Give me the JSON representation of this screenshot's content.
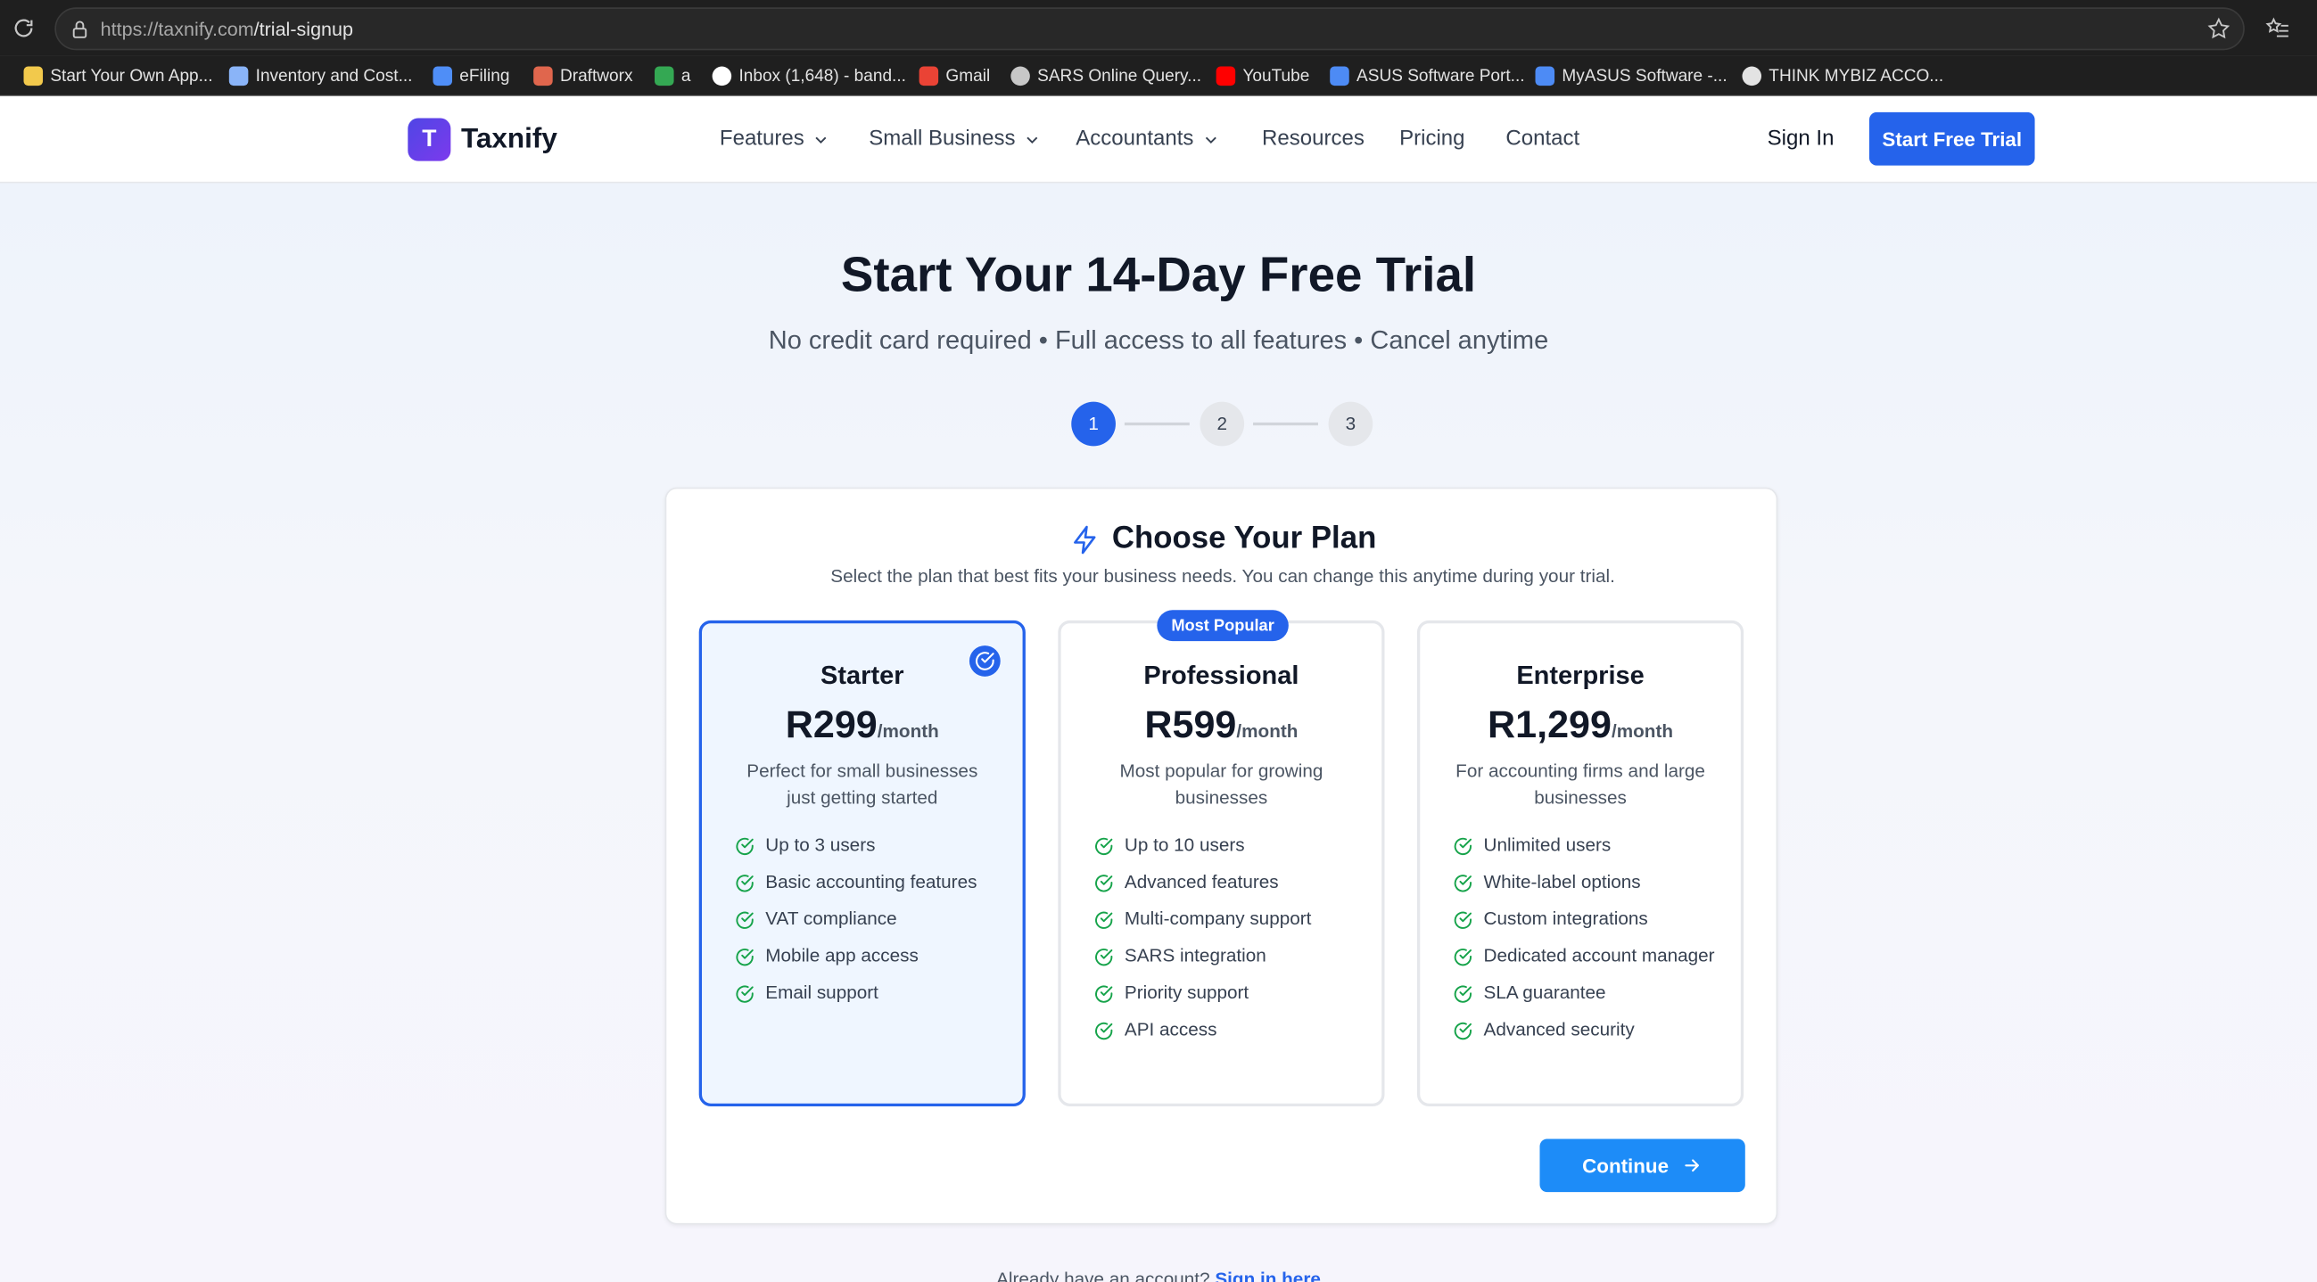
{
  "browser": {
    "url_host": "https://taxnify.com",
    "url_path": "/trial-signup",
    "bookmarks": [
      {
        "label": "Start Your Own App...",
        "icon": "app-favicon",
        "color": "#f2c94c"
      },
      {
        "label": "Inventory and Cost...",
        "icon": "ac-favicon",
        "color": "#8ab4f8"
      },
      {
        "label": "eFiling",
        "icon": "efiling-favicon",
        "color": "#4f8ef7"
      },
      {
        "label": "Draftworx",
        "icon": "draftworx-favicon",
        "color": "#e0664d"
      },
      {
        "label": "a",
        "icon": "leaf-favicon",
        "color": "#34a853"
      },
      {
        "label": "Inbox (1,648) - band...",
        "icon": "google-favicon",
        "color": "#ffffff"
      },
      {
        "label": "Gmail",
        "icon": "gmail-favicon",
        "color": "#ea4335"
      },
      {
        "label": "SARS Online Query...",
        "icon": "globe-favicon",
        "color": "#c7c7c7"
      },
      {
        "label": "YouTube",
        "icon": "youtube-favicon",
        "color": "#ff0000"
      },
      {
        "label": "ASUS Software Port...",
        "icon": "asus-favicon",
        "color": "#4d8bf5"
      },
      {
        "label": "MyASUS Software -...",
        "icon": "myasus-favicon",
        "color": "#4d8bf5"
      },
      {
        "label": "THINK MYBIZ ACCO...",
        "icon": "chatgpt-favicon",
        "color": "#e3e3e3"
      }
    ]
  },
  "nav": {
    "logo_letter": "T",
    "brand": "Taxnify",
    "items": [
      {
        "label": "Features",
        "dropdown": true
      },
      {
        "label": "Small Business",
        "dropdown": true
      },
      {
        "label": "Accountants",
        "dropdown": true
      },
      {
        "label": "Resources",
        "dropdown": false
      },
      {
        "label": "Pricing",
        "dropdown": false
      },
      {
        "label": "Contact",
        "dropdown": false
      }
    ],
    "sign_in": "Sign In",
    "cta": "Start Free Trial"
  },
  "hero": {
    "title": "Start Your 14-Day Free Trial",
    "subtitle": "No credit card required • Full access to all features • Cancel anytime"
  },
  "steps": {
    "labels": [
      "1",
      "2",
      "3"
    ],
    "current": 1
  },
  "plan_card": {
    "title": "Choose Your Plan",
    "subtitle": "Select the plan that best fits your business needs. You can change this anytime during your trial.",
    "plans": [
      {
        "name": "Starter",
        "price": "R299",
        "period": "/month",
        "description": "Perfect for small businesses just getting started",
        "selected": true,
        "badge": "",
        "features": [
          "Up to 3 users",
          "Basic accounting features",
          "VAT compliance",
          "Mobile app access",
          "Email support"
        ]
      },
      {
        "name": "Professional",
        "price": "R599",
        "period": "/month",
        "description": "Most popular for growing businesses",
        "selected": false,
        "badge": "Most Popular",
        "features": [
          "Up to 10 users",
          "Advanced features",
          "Multi-company support",
          "SARS integration",
          "Priority support",
          "API access"
        ]
      },
      {
        "name": "Enterprise",
        "price": "R1,299",
        "period": "/month",
        "description": "For accounting firms and large businesses",
        "selected": false,
        "badge": "",
        "features": [
          "Unlimited users",
          "White-label options",
          "Custom integrations",
          "Dedicated account manager",
          "SLA guarantee",
          "Advanced security"
        ]
      }
    ],
    "continue_label": "Continue"
  },
  "footer": {
    "prompt": "Already have an account?",
    "link": "Sign in here"
  },
  "colors": {
    "accent": "#2563eb",
    "check": "#16a34a",
    "continue": "#1d8cf8"
  }
}
